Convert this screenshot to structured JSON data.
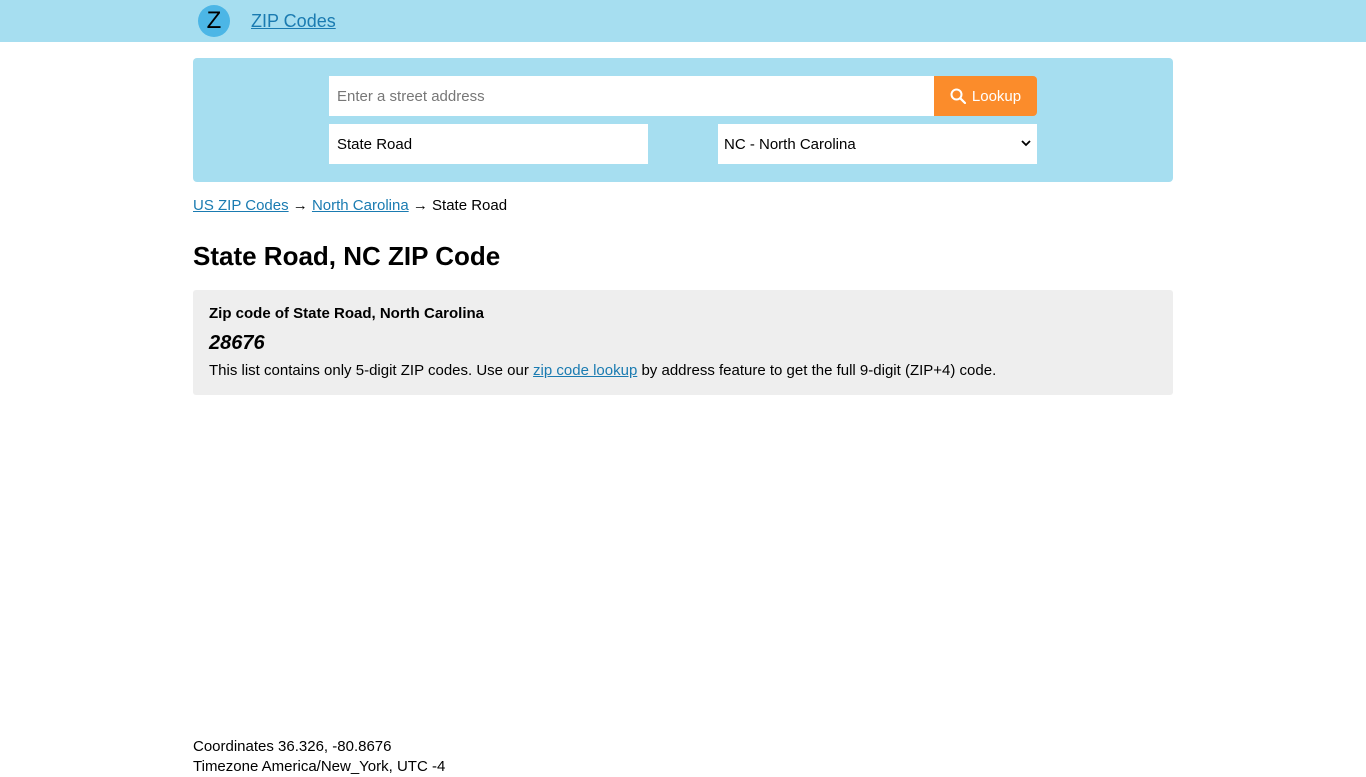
{
  "header": {
    "logo_letter": "Z",
    "brand": "ZIP Codes"
  },
  "search": {
    "address_placeholder": "Enter a street address",
    "address_value": "",
    "lookup_label": "Lookup",
    "city_value": "State Road",
    "state_selected": "NC - North Carolina"
  },
  "breadcrumb": {
    "home": "US ZIP Codes",
    "sep1": "→",
    "state": "North Carolina",
    "sep2": "→",
    "current": "State Road"
  },
  "page_title": "State Road, NC ZIP Code",
  "zip_card": {
    "heading": "Zip code of State Road, North Carolina",
    "zip": "28676",
    "note_before": "This list contains only 5-digit ZIP codes. Use our",
    "note_link": "zip code lookup",
    "note_after": "by address feature to get the full 9-digit (ZIP+4) code."
  },
  "info": {
    "coordinates": "Coordinates 36.326, -80.8676",
    "timezone": "Timezone America/New_York, UTC -4"
  },
  "colors": {
    "header_bg": "#a6def0",
    "accent_button": "#fb8c2b",
    "link": "#1a7bb1",
    "card_bg": "#eeeeee"
  }
}
